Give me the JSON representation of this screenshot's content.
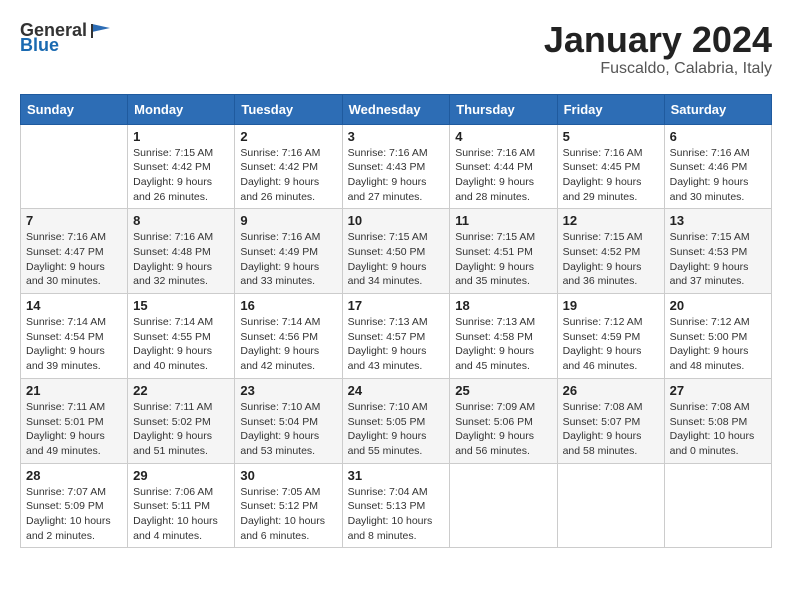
{
  "header": {
    "logo_general": "General",
    "logo_blue": "Blue",
    "month": "January 2024",
    "location": "Fuscaldo, Calabria, Italy"
  },
  "weekdays": [
    "Sunday",
    "Monday",
    "Tuesday",
    "Wednesday",
    "Thursday",
    "Friday",
    "Saturday"
  ],
  "weeks": [
    [
      {
        "day": "",
        "sunrise": "",
        "sunset": "",
        "daylight": ""
      },
      {
        "day": "1",
        "sunrise": "Sunrise: 7:15 AM",
        "sunset": "Sunset: 4:42 PM",
        "daylight": "Daylight: 9 hours and 26 minutes."
      },
      {
        "day": "2",
        "sunrise": "Sunrise: 7:16 AM",
        "sunset": "Sunset: 4:42 PM",
        "daylight": "Daylight: 9 hours and 26 minutes."
      },
      {
        "day": "3",
        "sunrise": "Sunrise: 7:16 AM",
        "sunset": "Sunset: 4:43 PM",
        "daylight": "Daylight: 9 hours and 27 minutes."
      },
      {
        "day": "4",
        "sunrise": "Sunrise: 7:16 AM",
        "sunset": "Sunset: 4:44 PM",
        "daylight": "Daylight: 9 hours and 28 minutes."
      },
      {
        "day": "5",
        "sunrise": "Sunrise: 7:16 AM",
        "sunset": "Sunset: 4:45 PM",
        "daylight": "Daylight: 9 hours and 29 minutes."
      },
      {
        "day": "6",
        "sunrise": "Sunrise: 7:16 AM",
        "sunset": "Sunset: 4:46 PM",
        "daylight": "Daylight: 9 hours and 30 minutes."
      }
    ],
    [
      {
        "day": "7",
        "sunrise": "Sunrise: 7:16 AM",
        "sunset": "Sunset: 4:47 PM",
        "daylight": "Daylight: 9 hours and 30 minutes."
      },
      {
        "day": "8",
        "sunrise": "Sunrise: 7:16 AM",
        "sunset": "Sunset: 4:48 PM",
        "daylight": "Daylight: 9 hours and 32 minutes."
      },
      {
        "day": "9",
        "sunrise": "Sunrise: 7:16 AM",
        "sunset": "Sunset: 4:49 PM",
        "daylight": "Daylight: 9 hours and 33 minutes."
      },
      {
        "day": "10",
        "sunrise": "Sunrise: 7:15 AM",
        "sunset": "Sunset: 4:50 PM",
        "daylight": "Daylight: 9 hours and 34 minutes."
      },
      {
        "day": "11",
        "sunrise": "Sunrise: 7:15 AM",
        "sunset": "Sunset: 4:51 PM",
        "daylight": "Daylight: 9 hours and 35 minutes."
      },
      {
        "day": "12",
        "sunrise": "Sunrise: 7:15 AM",
        "sunset": "Sunset: 4:52 PM",
        "daylight": "Daylight: 9 hours and 36 minutes."
      },
      {
        "day": "13",
        "sunrise": "Sunrise: 7:15 AM",
        "sunset": "Sunset: 4:53 PM",
        "daylight": "Daylight: 9 hours and 37 minutes."
      }
    ],
    [
      {
        "day": "14",
        "sunrise": "Sunrise: 7:14 AM",
        "sunset": "Sunset: 4:54 PM",
        "daylight": "Daylight: 9 hours and 39 minutes."
      },
      {
        "day": "15",
        "sunrise": "Sunrise: 7:14 AM",
        "sunset": "Sunset: 4:55 PM",
        "daylight": "Daylight: 9 hours and 40 minutes."
      },
      {
        "day": "16",
        "sunrise": "Sunrise: 7:14 AM",
        "sunset": "Sunset: 4:56 PM",
        "daylight": "Daylight: 9 hours and 42 minutes."
      },
      {
        "day": "17",
        "sunrise": "Sunrise: 7:13 AM",
        "sunset": "Sunset: 4:57 PM",
        "daylight": "Daylight: 9 hours and 43 minutes."
      },
      {
        "day": "18",
        "sunrise": "Sunrise: 7:13 AM",
        "sunset": "Sunset: 4:58 PM",
        "daylight": "Daylight: 9 hours and 45 minutes."
      },
      {
        "day": "19",
        "sunrise": "Sunrise: 7:12 AM",
        "sunset": "Sunset: 4:59 PM",
        "daylight": "Daylight: 9 hours and 46 minutes."
      },
      {
        "day": "20",
        "sunrise": "Sunrise: 7:12 AM",
        "sunset": "Sunset: 5:00 PM",
        "daylight": "Daylight: 9 hours and 48 minutes."
      }
    ],
    [
      {
        "day": "21",
        "sunrise": "Sunrise: 7:11 AM",
        "sunset": "Sunset: 5:01 PM",
        "daylight": "Daylight: 9 hours and 49 minutes."
      },
      {
        "day": "22",
        "sunrise": "Sunrise: 7:11 AM",
        "sunset": "Sunset: 5:02 PM",
        "daylight": "Daylight: 9 hours and 51 minutes."
      },
      {
        "day": "23",
        "sunrise": "Sunrise: 7:10 AM",
        "sunset": "Sunset: 5:04 PM",
        "daylight": "Daylight: 9 hours and 53 minutes."
      },
      {
        "day": "24",
        "sunrise": "Sunrise: 7:10 AM",
        "sunset": "Sunset: 5:05 PM",
        "daylight": "Daylight: 9 hours and 55 minutes."
      },
      {
        "day": "25",
        "sunrise": "Sunrise: 7:09 AM",
        "sunset": "Sunset: 5:06 PM",
        "daylight": "Daylight: 9 hours and 56 minutes."
      },
      {
        "day": "26",
        "sunrise": "Sunrise: 7:08 AM",
        "sunset": "Sunset: 5:07 PM",
        "daylight": "Daylight: 9 hours and 58 minutes."
      },
      {
        "day": "27",
        "sunrise": "Sunrise: 7:08 AM",
        "sunset": "Sunset: 5:08 PM",
        "daylight": "Daylight: 10 hours and 0 minutes."
      }
    ],
    [
      {
        "day": "28",
        "sunrise": "Sunrise: 7:07 AM",
        "sunset": "Sunset: 5:09 PM",
        "daylight": "Daylight: 10 hours and 2 minutes."
      },
      {
        "day": "29",
        "sunrise": "Sunrise: 7:06 AM",
        "sunset": "Sunset: 5:11 PM",
        "daylight": "Daylight: 10 hours and 4 minutes."
      },
      {
        "day": "30",
        "sunrise": "Sunrise: 7:05 AM",
        "sunset": "Sunset: 5:12 PM",
        "daylight": "Daylight: 10 hours and 6 minutes."
      },
      {
        "day": "31",
        "sunrise": "Sunrise: 7:04 AM",
        "sunset": "Sunset: 5:13 PM",
        "daylight": "Daylight: 10 hours and 8 minutes."
      },
      {
        "day": "",
        "sunrise": "",
        "sunset": "",
        "daylight": ""
      },
      {
        "day": "",
        "sunrise": "",
        "sunset": "",
        "daylight": ""
      },
      {
        "day": "",
        "sunrise": "",
        "sunset": "",
        "daylight": ""
      }
    ]
  ]
}
